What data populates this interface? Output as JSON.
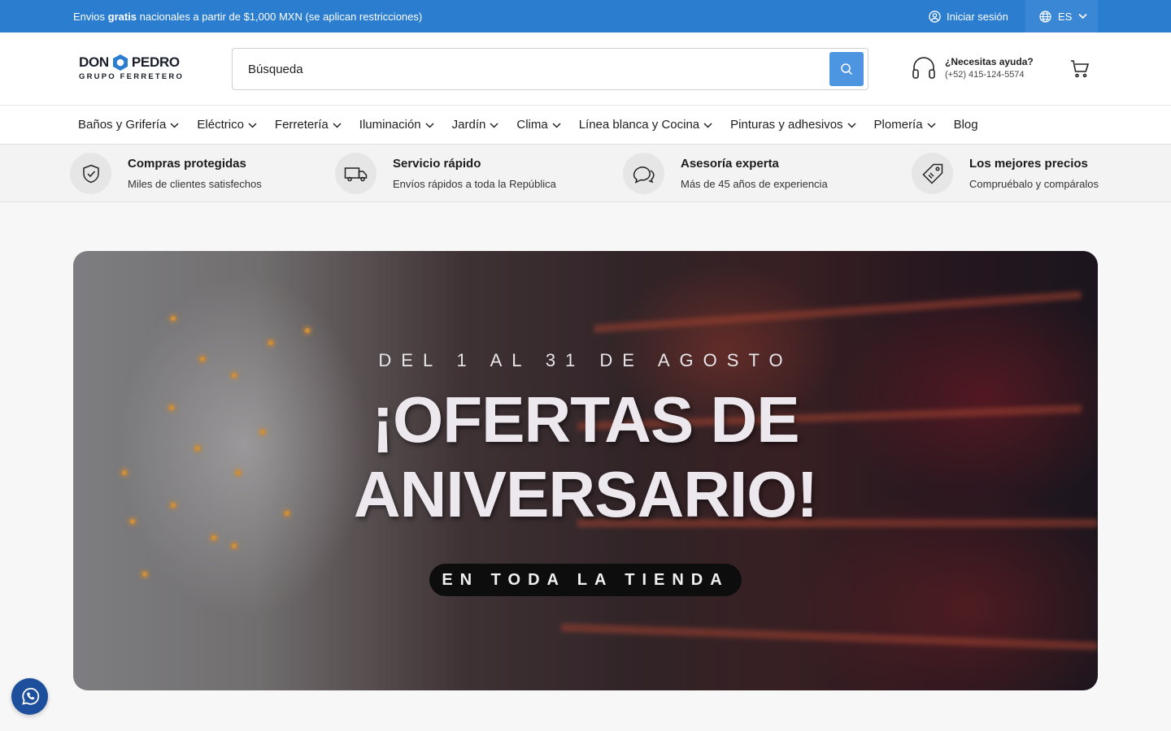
{
  "topbar": {
    "msg_pre": "Envios ",
    "msg_bold": "gratis",
    "msg_post": " nacionales a partir de $1,000 MXN (se aplican restricciones)",
    "login": "Iniciar sesión",
    "lang": "ES"
  },
  "logo": {
    "line1a": "DON",
    "line1b": "PEDRO",
    "line2": "GRUPO FERRETERO"
  },
  "search": {
    "placeholder": "Búsqueda"
  },
  "help": {
    "title": "¿Necesitas ayuda?",
    "phone": "(+52) 415-124-5574"
  },
  "nav": {
    "items": [
      {
        "label": "Baños y Grifería"
      },
      {
        "label": "Eléctrico"
      },
      {
        "label": "Ferretería"
      },
      {
        "label": "Iluminación"
      },
      {
        "label": "Jardín"
      },
      {
        "label": "Clima"
      },
      {
        "label": "Línea blanca y Cocina"
      },
      {
        "label": "Pinturas y adhesivos"
      },
      {
        "label": "Plomería"
      },
      {
        "label": "Blog"
      }
    ]
  },
  "features": [
    {
      "title": "Compras protegidas",
      "sub": "Miles de clientes satisfechos",
      "icon": "shield-check-icon"
    },
    {
      "title": "Servicio rápido",
      "sub": "Envíos rápidos a toda la República",
      "icon": "truck-icon"
    },
    {
      "title": "Asesoría experta",
      "sub": "Más de 45 años de experiencia",
      "icon": "chat-bubbles-icon"
    },
    {
      "title": "Los mejores precios",
      "sub": "Compruébalo y compáralos",
      "icon": "price-tag-icon"
    }
  ],
  "hero": {
    "line1": "DEL 1 AL 31 DE AGOSTO",
    "line2": "¡OFERTAS DE",
    "line3": "ANIVERSARIO!",
    "pill": "EN TODA LA TIENDA"
  },
  "colors": {
    "topbar": "#2b7dd0",
    "search_button": "#4d95e0",
    "whatsapp": "#1d4f9c"
  }
}
